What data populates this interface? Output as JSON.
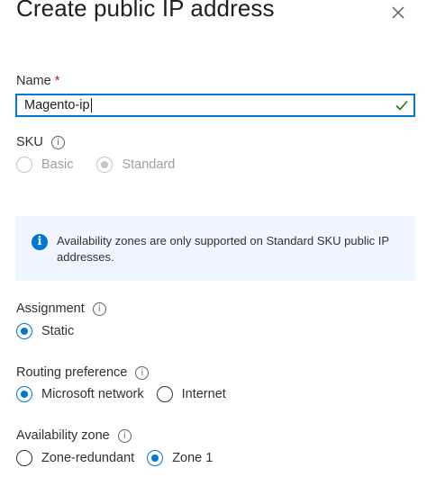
{
  "header": {
    "title": "Create public IP address"
  },
  "name_field": {
    "label": "Name",
    "required_marker": "*",
    "value": "Magento-ip"
  },
  "sku": {
    "label": "SKU",
    "options": [
      {
        "label": "Basic",
        "selected": false
      },
      {
        "label": "Standard",
        "selected": true
      }
    ]
  },
  "info_message": "Availability zones are only supported on Standard SKU public IP addresses.",
  "assignment": {
    "label": "Assignment",
    "options": [
      {
        "label": "Static",
        "selected": true
      }
    ]
  },
  "routing": {
    "label": "Routing preference",
    "options": [
      {
        "label": "Microsoft network",
        "selected": true
      },
      {
        "label": "Internet",
        "selected": false
      }
    ]
  },
  "availability_zone": {
    "label": "Availability zone",
    "options": [
      {
        "label": "Zone-redundant",
        "selected": false
      },
      {
        "label": "Zone 1",
        "selected": true
      }
    ]
  },
  "colors": {
    "accent": "#0078d4",
    "success": "#107c10",
    "required": "#a4262c",
    "info_bg": "#f0f6ff"
  },
  "icons": {
    "close": "close-icon",
    "check": "checkmark-icon",
    "info": "info-icon",
    "tooltip": "info-circle-icon"
  }
}
